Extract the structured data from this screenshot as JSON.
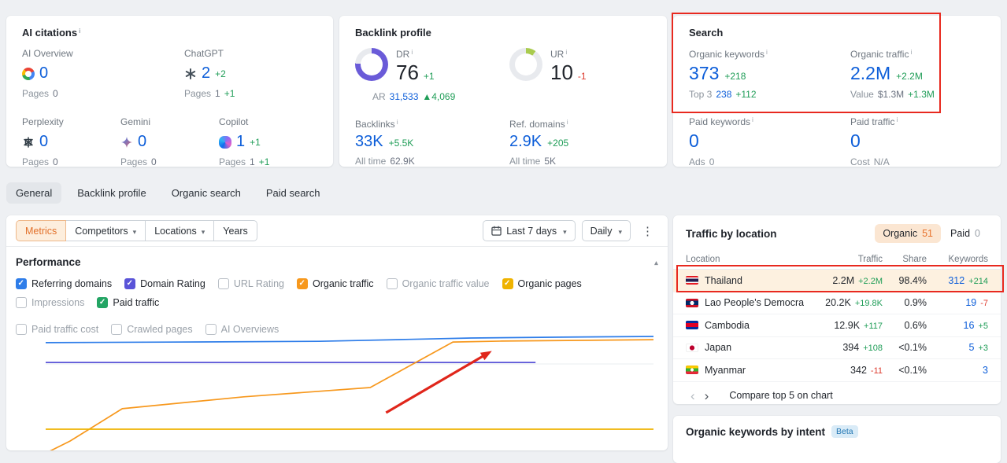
{
  "ai_citations": {
    "title": "AI citations",
    "pages_label": "Pages",
    "items": [
      {
        "name": "AI Overview",
        "icon": "google-g",
        "value": "0",
        "change": "",
        "pages": "0",
        "pages_change": ""
      },
      {
        "name": "ChatGPT",
        "icon": "chatgpt",
        "value": "2",
        "change": "+2",
        "pages": "1",
        "pages_change": "+1"
      },
      {
        "name": "Perplexity",
        "icon": "perplexity",
        "value": "0",
        "change": "",
        "pages": "0",
        "pages_change": ""
      },
      {
        "name": "Gemini",
        "icon": "gemini",
        "value": "0",
        "change": "",
        "pages": "0",
        "pages_change": ""
      },
      {
        "name": "Copilot",
        "icon": "copilot",
        "value": "1",
        "change": "+1",
        "pages": "1",
        "pages_change": "+1"
      }
    ]
  },
  "backlink_profile": {
    "title": "Backlink profile",
    "dr": {
      "label": "DR",
      "value": "76",
      "change": "+1",
      "percent": 76,
      "ar_label": "AR",
      "ar_value": "31,533",
      "ar_change": "▲4,069"
    },
    "ur": {
      "label": "UR",
      "value": "10",
      "change": "-1",
      "percent": 10
    },
    "backlinks": {
      "label": "Backlinks",
      "value": "33K",
      "change": "+5.5K",
      "alltime_label": "All time",
      "alltime_value": "62.9K"
    },
    "ref_domains": {
      "label": "Ref. domains",
      "value": "2.9K",
      "change": "+205",
      "alltime_label": "All time",
      "alltime_value": "5K"
    }
  },
  "search": {
    "title": "Search",
    "organic_keywords": {
      "label": "Organic keywords",
      "value": "373",
      "change": "+218",
      "sub_label": "Top 3",
      "sub_value": "238",
      "sub_change": "+112"
    },
    "organic_traffic": {
      "label": "Organic traffic",
      "value": "2.2M",
      "change": "+2.2M",
      "sub_label": "Value",
      "sub_value": "$1.3M",
      "sub_change": "+1.3M"
    },
    "paid_keywords": {
      "label": "Paid keywords",
      "value": "0",
      "change": "",
      "sub_label": "Ads",
      "sub_value": "0",
      "sub_change": ""
    },
    "paid_traffic": {
      "label": "Paid traffic",
      "value": "0",
      "change": "",
      "sub_label": "Cost",
      "sub_value": "N/A",
      "sub_change": ""
    }
  },
  "tabs": [
    {
      "label": "General",
      "active": true
    },
    {
      "label": "Backlink profile",
      "active": false
    },
    {
      "label": "Organic search",
      "active": false
    },
    {
      "label": "Paid search",
      "active": false
    }
  ],
  "toolbar": {
    "metrics": "Metrics",
    "competitors": "Competitors",
    "locations": "Locations",
    "years": "Years",
    "date_range": "Last 7 days",
    "granularity": "Daily"
  },
  "performance": {
    "title": "Performance",
    "metrics": [
      {
        "label": "Referring domains",
        "checked": true,
        "color": "#2e7de9"
      },
      {
        "label": "Domain Rating",
        "checked": true,
        "color": "#5a54d8"
      },
      {
        "label": "URL Rating",
        "checked": false,
        "color": null
      },
      {
        "label": "Organic traffic",
        "checked": true,
        "color": "#f7981d"
      },
      {
        "label": "Organic traffic value",
        "checked": false,
        "color": null
      },
      {
        "label": "Organic pages",
        "checked": true,
        "color": "#efb300"
      },
      {
        "label": "Impressions",
        "checked": false,
        "color": null
      },
      {
        "label": "Paid traffic",
        "checked": true,
        "color": "#23a564"
      },
      {
        "label": "Paid traffic cost",
        "checked": false,
        "color": null
      },
      {
        "label": "Crawled pages",
        "checked": false,
        "color": null
      },
      {
        "label": "AI Overviews",
        "checked": false,
        "color": null
      }
    ]
  },
  "chart_data": {
    "type": "line",
    "x_range_label": "Last 7 days, daily",
    "legend_position": "top-checkboxes",
    "grid": "horizontal-light",
    "series": [
      {
        "name": "Referring domains",
        "color": "#2e7de9",
        "approx_trend": "~2.9K nearly flat, slight rise",
        "points": [
          [
            0,
            19
          ],
          [
            20,
            18.6
          ],
          [
            45,
            18
          ],
          [
            60,
            16.5
          ],
          [
            70,
            15.5
          ],
          [
            85,
            14.8
          ],
          [
            100,
            14.3
          ]
        ]
      },
      {
        "name": "Domain Rating",
        "color": "#5a54d8",
        "approx_trend": "flat at 76, series ends at ~80% of range",
        "points": [
          [
            0,
            34
          ],
          [
            80.6,
            34
          ]
        ]
      },
      {
        "name": "Organic traffic",
        "color": "#f7981d",
        "approx_trend": "rises from ~0 to 2.2M with steep jump near end",
        "points": [
          [
            0.3,
            102
          ],
          [
            4,
            93.5
          ],
          [
            12.6,
            69
          ],
          [
            32.6,
            60
          ],
          [
            53.4,
            53
          ],
          [
            67,
            18.5
          ],
          [
            75,
            17.8
          ],
          [
            100,
            16.7
          ]
        ]
      },
      {
        "name": "Organic pages",
        "color": "#efb300",
        "approx_trend": "flat low",
        "points": [
          [
            0,
            84.5
          ],
          [
            100,
            84.5
          ]
        ]
      },
      {
        "name": "Paid traffic",
        "color": "#23a564",
        "approx_trend": "flat at 0 (below visible area)",
        "points": [
          [
            0,
            101.5
          ],
          [
            100,
            101.5
          ]
        ]
      }
    ],
    "gridlines_y": [
      35.1
    ],
    "annotation_arrow": {
      "from": [
        56,
        72
      ],
      "to": [
        72.4,
        28
      ],
      "color": "#e0261b"
    }
  },
  "traffic_by_location": {
    "title": "Traffic by location",
    "toggle": {
      "organic_label": "Organic",
      "organic_count": "51",
      "paid_label": "Paid",
      "paid_count": "0"
    },
    "columns": [
      "Location",
      "Traffic",
      "Share",
      "Keywords"
    ],
    "rows": [
      {
        "flag": "th",
        "location": "Thailand",
        "traffic": "2.2M",
        "traffic_change": "+2.2M",
        "share": "98.4%",
        "keywords": "312",
        "keywords_change": "+214"
      },
      {
        "flag": "la",
        "location": "Lao People's Democratic Reput",
        "traffic": "20.2K",
        "traffic_change": "+19.8K",
        "share": "0.9%",
        "keywords": "19",
        "keywords_change": "-7"
      },
      {
        "flag": "kh",
        "location": "Cambodia",
        "traffic": "12.9K",
        "traffic_change": "+117",
        "share": "0.6%",
        "keywords": "16",
        "keywords_change": "+5"
      },
      {
        "flag": "jp",
        "location": "Japan",
        "traffic": "394",
        "traffic_change": "+108",
        "share": "<0.1%",
        "keywords": "5",
        "keywords_change": "+3"
      },
      {
        "flag": "mm",
        "location": "Myanmar",
        "traffic": "342",
        "traffic_change": "-11",
        "share": "<0.1%",
        "keywords": "3",
        "keywords_change": ""
      }
    ],
    "footer_label": "Compare top 5 on chart"
  },
  "intent": {
    "title": "Organic keywords by intent",
    "badge": "Beta"
  }
}
